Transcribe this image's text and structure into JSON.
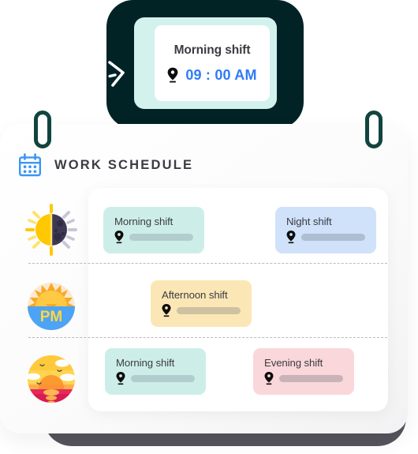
{
  "tooltip": {
    "title": "Morning shift",
    "time": "09 : 00 AM",
    "pin_icon": "location-pin-icon",
    "frame_color": "#d3f2ee",
    "time_color": "#2f7bf6"
  },
  "arrow": {
    "icon": "dashed-curved-arrow-icon",
    "color": "#ffffff"
  },
  "clips": [
    {
      "name": "clip-left",
      "color": "#12443f"
    },
    {
      "name": "clip-right",
      "color": "#12443f"
    }
  ],
  "header": {
    "icon": "calendar-icon",
    "icon_color": "#3b95f5",
    "title": "WORK SCHEDULE"
  },
  "rows": [
    {
      "icon": "sun-behind-moon-icon",
      "chips": [
        {
          "label": "Morning shift",
          "bg": "#cdeee8",
          "bar": "#b2cdce",
          "pin_icon": "location-pin-icon"
        },
        {
          "label": "Night shift",
          "bg": "#cfe2fa",
          "bar": "#adbdd2",
          "pin_icon": "location-pin-icon"
        }
      ]
    },
    {
      "icon": "pm-sun-icon",
      "chips": [
        {
          "label": "Afternoon shift",
          "bg": "#fbe7b5",
          "bar": "#cfc2a2",
          "pin_icon": "location-pin-icon"
        }
      ]
    },
    {
      "icon": "sunset-icon",
      "chips": [
        {
          "label": "Morning shift",
          "bg": "#cdeee8",
          "bar": "#b2cdce",
          "pin_icon": "location-pin-icon"
        },
        {
          "label": "Evening shift",
          "bg": "#fad7da",
          "bar": "#c9b2b8",
          "pin_icon": "location-pin-icon"
        }
      ]
    }
  ],
  "colors": {
    "dark_panel": "#012326",
    "shadow_panel": "#55545c",
    "panel_bg": "#ffffff",
    "text": "#3b3b42"
  }
}
